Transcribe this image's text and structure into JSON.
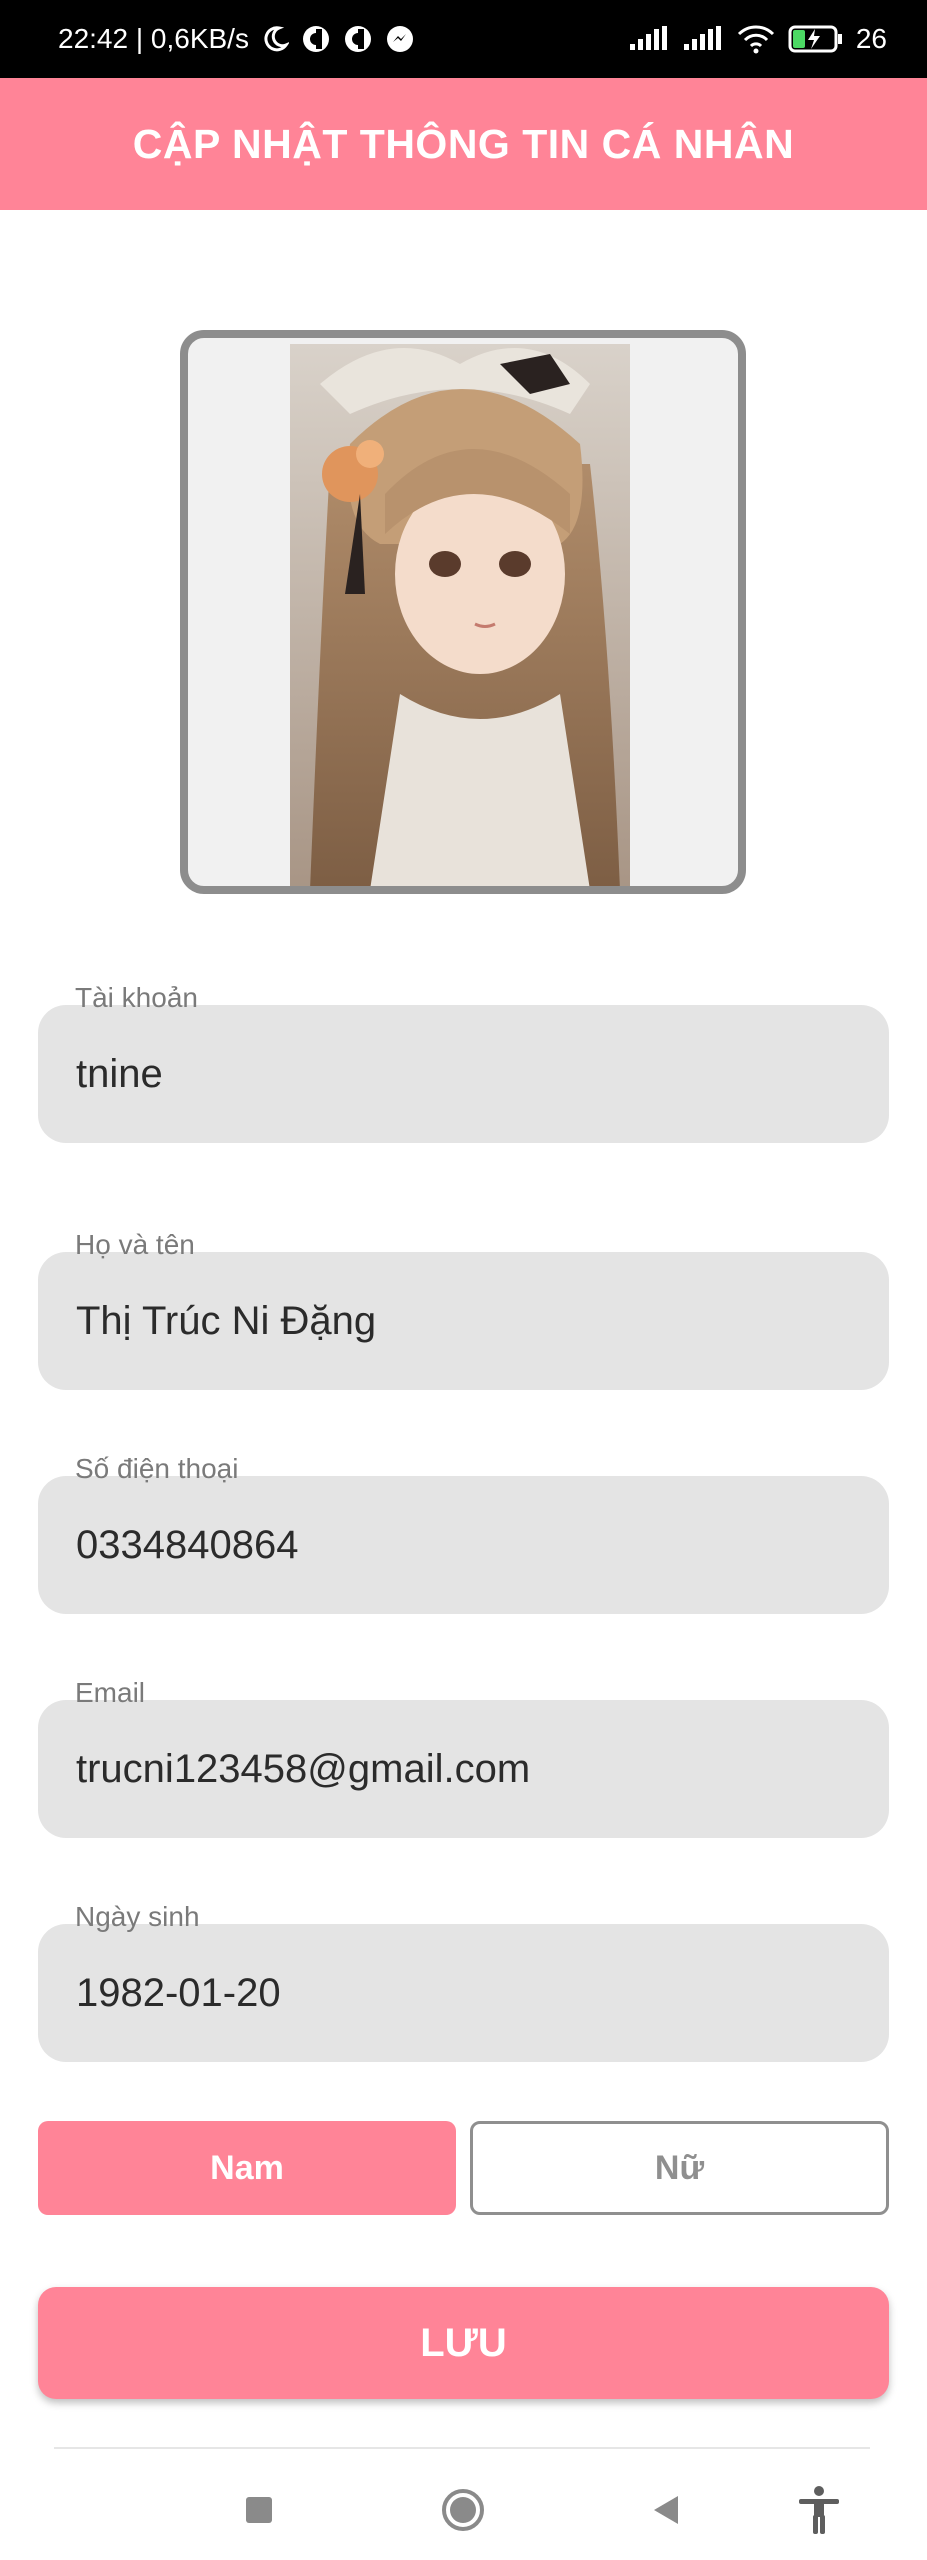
{
  "status_bar": {
    "time": "22:42 | 0,6KB/s",
    "battery": "26"
  },
  "header": {
    "title": "CẬP NHẬT THÔNG TIN CÁ NHÂN"
  },
  "avatar": {
    "icon": "profile-photo"
  },
  "form": {
    "fields": [
      {
        "label": "Tài khoản",
        "value": "tnine"
      },
      {
        "label": "Họ và tên",
        "value": "Thị Trúc Ni Đặng"
      },
      {
        "label": "Số điện thoại",
        "value": "0334840864"
      },
      {
        "label": "Email",
        "value": "trucni123458@gmail.com"
      },
      {
        "label": "Ngày sinh",
        "value": "1982-01-20"
      }
    ],
    "gender": {
      "male": "Nam",
      "female": "Nữ",
      "selected": "Nam"
    },
    "save_label": "LƯU"
  },
  "colors": {
    "accent": "#ff8497",
    "field_bg": "#e4e4e4",
    "status_bar": "#000000"
  }
}
